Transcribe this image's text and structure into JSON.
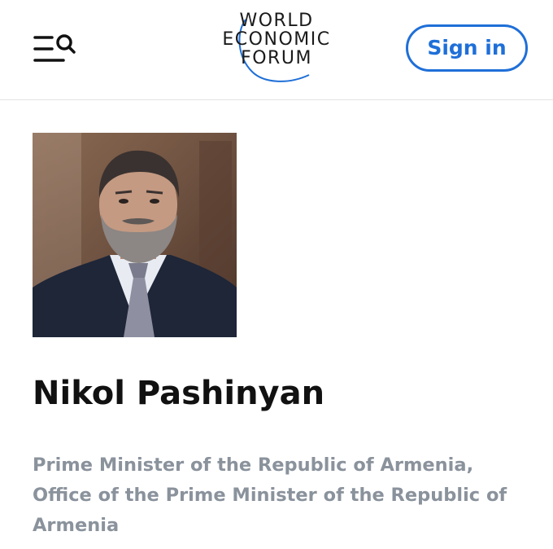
{
  "header": {
    "menu_icon": "menu-search-icon",
    "logo_lines": [
      "WORLD",
      "ECONOMIC",
      "FORUM"
    ],
    "sign_in_label": "Sign in",
    "accent_color": "#1f6fd8"
  },
  "profile": {
    "photo_alt": "Nikol Pashinyan",
    "name": "Nikol Pashinyan",
    "role": "Prime Minister of the Republic of Armenia, Office of the Prime Minister of the Republic of Armenia"
  }
}
